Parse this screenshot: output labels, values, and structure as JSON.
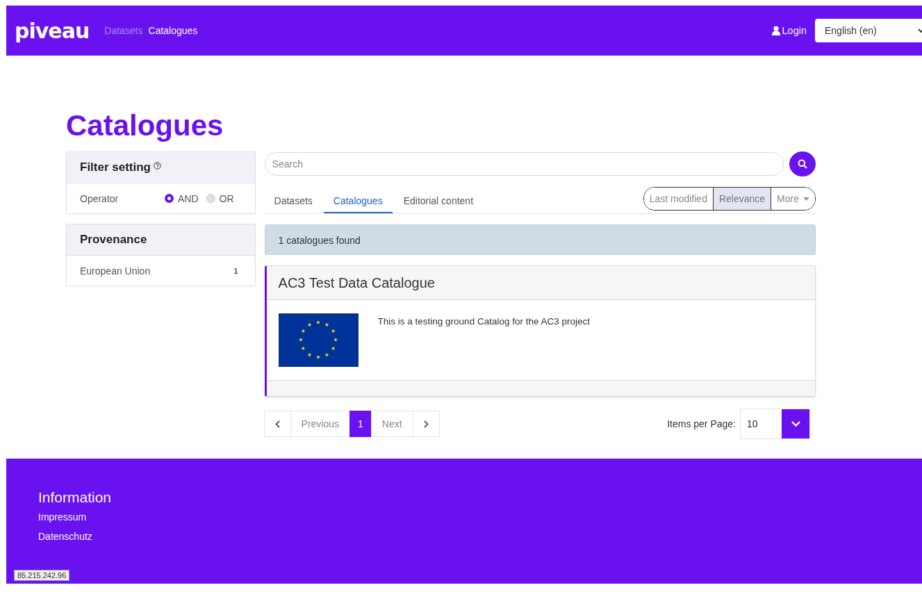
{
  "header": {
    "logo": "piveau",
    "nav": [
      {
        "label": "Datasets",
        "selected": false
      },
      {
        "label": "Catalogues",
        "selected": true
      }
    ],
    "login": "Login",
    "language": "English (en)"
  },
  "title": "Catalogues",
  "filter": {
    "title": "Filter setting",
    "operator_label": "Operator",
    "options": [
      {
        "label": "AND",
        "selected": true
      },
      {
        "label": "OR",
        "selected": false
      }
    ]
  },
  "provenance": {
    "title": "Provenance",
    "items": [
      {
        "label": "European Union",
        "count": "1"
      }
    ]
  },
  "search": {
    "placeholder": "Search"
  },
  "tabs": [
    {
      "label": "Datasets",
      "selected": false
    },
    {
      "label": "Catalogues",
      "selected": true
    },
    {
      "label": "Editorial content",
      "selected": false
    }
  ],
  "sort": [
    {
      "label": "Last modified",
      "kind": "option",
      "selected": false
    },
    {
      "label": "Relevance",
      "kind": "option",
      "selected": true
    },
    {
      "label": "More",
      "kind": "dropdown",
      "selected": false
    }
  ],
  "results": "1 catalogues found",
  "catalogues": [
    {
      "title": "AC3 Test Data Catalogue",
      "description": "This is a testing ground Catalog for the AC3 project"
    }
  ],
  "pagination": {
    "previous": "Previous",
    "next": "Next",
    "pages": [
      {
        "label": "1",
        "selected": true
      }
    ]
  },
  "per_page": {
    "label": "Items per Page:",
    "value": "10"
  },
  "footer": {
    "heading": "Information",
    "links": [
      "Impressum",
      "Datenschutz"
    ]
  },
  "status_tooltip": "85.215.242.96"
}
